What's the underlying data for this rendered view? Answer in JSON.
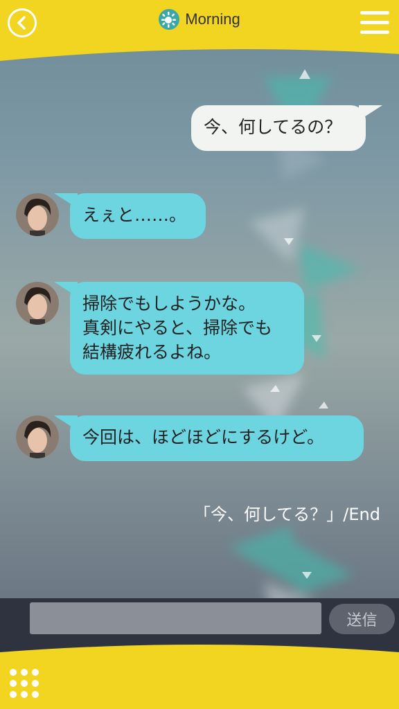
{
  "header": {
    "title": "Morning",
    "back_icon": "chevron-left-icon",
    "title_icon": "sun-icon",
    "menu_icon": "hamburger-menu-icon",
    "colors": {
      "header_bg": "#f1d520",
      "title_icon_bg": "#3ba7a8"
    }
  },
  "messages": [
    {
      "side": "right",
      "lines": [
        "今、何してるの？"
      ]
    },
    {
      "side": "left",
      "lines": [
        "えぇと……。"
      ]
    },
    {
      "side": "left",
      "lines": [
        "掃除でもしようかな。",
        "真剣にやると、掃除でも",
        "結構疲れるよね。"
      ]
    },
    {
      "side": "left",
      "lines": [
        "今回は、ほどほどにするけど。"
      ]
    }
  ],
  "end_label": "「今、何してる？」/End",
  "input": {
    "value": "",
    "placeholder": ""
  },
  "send_label": "送信",
  "footer": {
    "grid_icon": "grid-menu-icon",
    "colors": {
      "footer_bg": "#f1d520",
      "bar_bg": "#2f3340"
    }
  },
  "colors": {
    "bubble_left": "#6cd5e0",
    "bubble_right": "#f2f4f2"
  }
}
